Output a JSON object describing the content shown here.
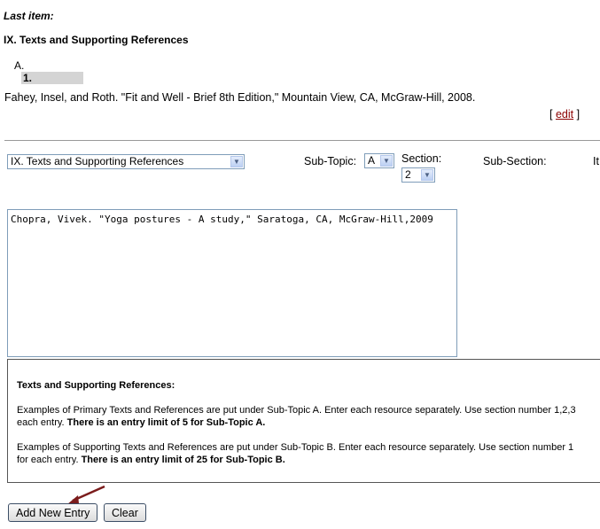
{
  "last_item": {
    "label": "Last item:",
    "title": "IX. Texts and Supporting References",
    "subtopic": "A.",
    "number": "1.",
    "reference": "Fahey, Insel, and Roth. \"Fit and Well - Brief 8th Edition,\" Mountain View, CA, McGraw-Hill, 2008.",
    "edit_open": "[",
    "edit_label": "edit",
    "edit_close": "]"
  },
  "form": {
    "topic_value": "IX. Texts and Supporting References",
    "subtopic_label": "Sub-Topic:",
    "subtopic_value": "A",
    "section_label": "Section:",
    "section_value": "2",
    "subsection_label": "Sub-Section:",
    "item_label_partial": "It",
    "entry_text": "Chopra, Vivek. \"Yoga postures - A study,\" Saratoga, CA, McGraw-Hill,2009"
  },
  "info": {
    "heading": "Texts and Supporting References:",
    "p1_line1": "Examples of Primary Texts and References are put under Sub-Topic A. Enter each resource separately. Use section number 1,2,3",
    "p1_line2_a": "each entry. ",
    "p1_line2_b": "There is an entry limit of 5 for Sub-Topic A.",
    "p2_line1": "Examples of Supporting Texts and References are put under Sub-Topic B. Enter each resource separately. Use section number 1",
    "p2_line2_a": "for each entry. ",
    "p2_line2_b": "There is an entry limit of 25 for Sub-Topic B."
  },
  "buttons": {
    "add": "Add New Entry",
    "clear": "Clear"
  },
  "colors": {
    "link": "#8b0000",
    "arrow": "#7b1c1c"
  }
}
